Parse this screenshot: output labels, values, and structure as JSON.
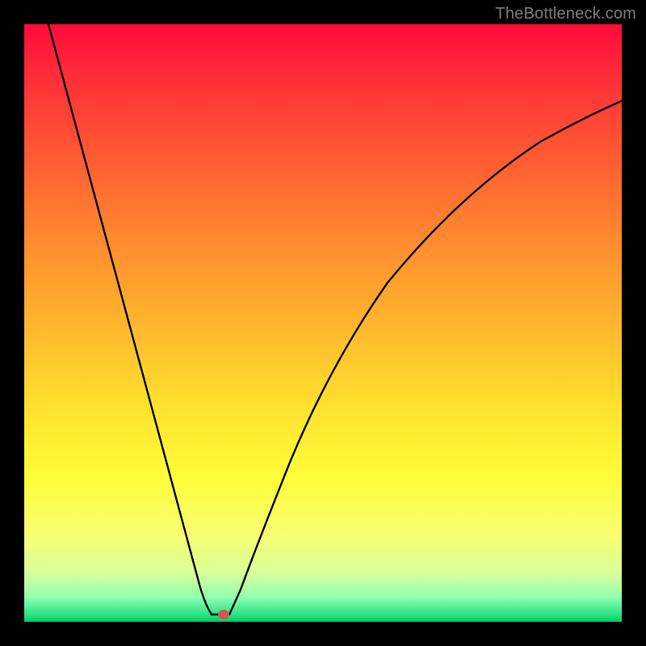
{
  "watermark": "TheBottleneck.com",
  "marker": {
    "color": "#cc5a52",
    "cx": 247,
    "cy": 731,
    "rx": 7,
    "ry": 6
  },
  "curve_stroke": "#000000",
  "chart_data": {
    "type": "line",
    "title": "",
    "xlabel": "",
    "ylabel": "",
    "xlim": [
      0,
      100
    ],
    "ylim": [
      0,
      100
    ],
    "x": [
      0,
      3,
      6,
      9,
      12,
      15,
      18,
      21,
      24,
      27,
      29,
      30,
      31,
      32,
      34,
      35,
      37,
      40,
      43,
      47,
      52,
      58,
      65,
      73,
      82,
      91,
      100
    ],
    "values": [
      100,
      89,
      78,
      67,
      56,
      45,
      34,
      23,
      12,
      3,
      1,
      1,
      1,
      1,
      2,
      3,
      7,
      14,
      23,
      32,
      41,
      49,
      56,
      62,
      67,
      71,
      74
    ],
    "marker_point": {
      "x": 31,
      "y": 1
    },
    "note": "Values are approximate percentages read from the plot; axes are unlabeled in the source image."
  }
}
